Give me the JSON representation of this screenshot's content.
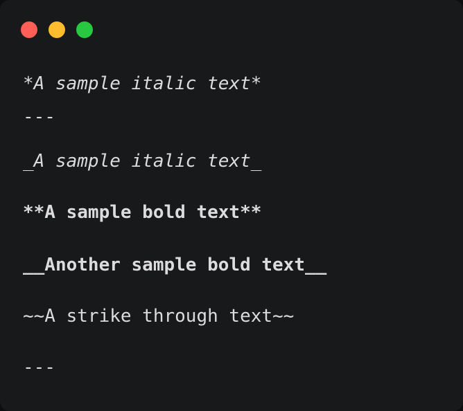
{
  "window": {
    "traffic_lights": {
      "close_color": "#ff5f57",
      "minimize_color": "#febc2e",
      "zoom_color": "#28c840"
    }
  },
  "code": {
    "lines": [
      "*A sample italic text*",
      "---",
      "_A sample italic text_",
      "**A sample bold text**",
      "__Another sample bold text__",
      "~~A strike through text~~",
      "---"
    ]
  }
}
